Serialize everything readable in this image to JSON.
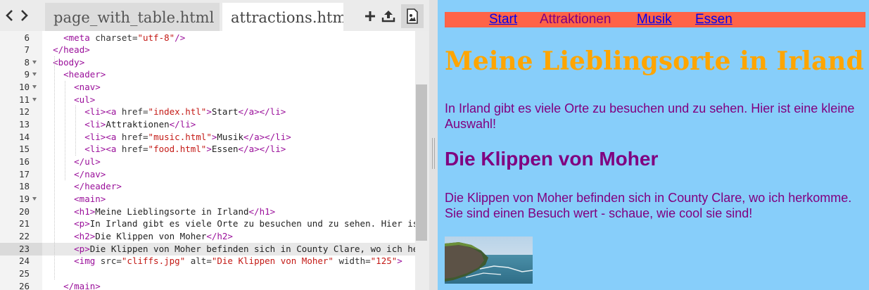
{
  "editor": {
    "tabs": [
      {
        "label": "page_with_table.html"
      },
      {
        "label": "attractions.html"
      }
    ],
    "lines": [
      {
        "num": "6",
        "fold": false
      },
      {
        "num": "7",
        "fold": false
      },
      {
        "num": "8",
        "fold": true
      },
      {
        "num": "9",
        "fold": true
      },
      {
        "num": "10",
        "fold": true
      },
      {
        "num": "11",
        "fold": true
      },
      {
        "num": "12",
        "fold": false
      },
      {
        "num": "13",
        "fold": false
      },
      {
        "num": "14",
        "fold": false
      },
      {
        "num": "15",
        "fold": false
      },
      {
        "num": "16",
        "fold": false
      },
      {
        "num": "17",
        "fold": false
      },
      {
        "num": "18",
        "fold": false
      },
      {
        "num": "19",
        "fold": true
      },
      {
        "num": "20",
        "fold": false
      },
      {
        "num": "21",
        "fold": false
      },
      {
        "num": "22",
        "fold": false
      },
      {
        "num": "23",
        "fold": false,
        "active": true
      },
      {
        "num": "24",
        "fold": false
      },
      {
        "num": "25",
        "fold": false
      },
      {
        "num": "26",
        "fold": false
      }
    ],
    "code": [
      {
        "indent": "    ",
        "parts": [
          [
            "tag",
            "<meta "
          ],
          [
            "attr",
            "charset="
          ],
          [
            "str",
            "\"utf-8\""
          ],
          [
            "tag",
            "/>"
          ]
        ]
      },
      {
        "indent": "  ",
        "parts": [
          [
            "tag",
            "</head>"
          ]
        ]
      },
      {
        "indent": "  ",
        "parts": [
          [
            "tag",
            "<body>"
          ]
        ]
      },
      {
        "indent": "    ",
        "parts": [
          [
            "tag",
            "<header>"
          ]
        ]
      },
      {
        "indent": "      ",
        "parts": [
          [
            "tag",
            "<nav>"
          ]
        ]
      },
      {
        "indent": "      ",
        "parts": [
          [
            "tag",
            "<ul>"
          ]
        ]
      },
      {
        "indent": "        ",
        "parts": [
          [
            "tag",
            "<li><a "
          ],
          [
            "attr",
            "href="
          ],
          [
            "str",
            "\"index.htl\""
          ],
          [
            "tag",
            ">"
          ],
          [
            "text",
            "Start"
          ],
          [
            "tag",
            "</a></li>"
          ]
        ]
      },
      {
        "indent": "        ",
        "parts": [
          [
            "tag",
            "<li>"
          ],
          [
            "text",
            "Attraktionen"
          ],
          [
            "tag",
            "</li>"
          ]
        ]
      },
      {
        "indent": "        ",
        "parts": [
          [
            "tag",
            "<li><a "
          ],
          [
            "attr",
            "href="
          ],
          [
            "str",
            "\"music.html\""
          ],
          [
            "tag",
            ">"
          ],
          [
            "text",
            "Musik"
          ],
          [
            "tag",
            "</a></li>"
          ]
        ]
      },
      {
        "indent": "        ",
        "parts": [
          [
            "tag",
            "<li><a "
          ],
          [
            "attr",
            "href="
          ],
          [
            "str",
            "\"food.html\""
          ],
          [
            "tag",
            ">"
          ],
          [
            "text",
            "Essen"
          ],
          [
            "tag",
            "</a></li>"
          ]
        ]
      },
      {
        "indent": "      ",
        "parts": [
          [
            "tag",
            "</ul>"
          ]
        ]
      },
      {
        "indent": "      ",
        "parts": [
          [
            "tag",
            "</nav>"
          ]
        ]
      },
      {
        "indent": "      ",
        "parts": [
          [
            "tag",
            "</header>"
          ]
        ]
      },
      {
        "indent": "      ",
        "parts": [
          [
            "tag",
            "<main>"
          ]
        ]
      },
      {
        "indent": "      ",
        "parts": [
          [
            "tag",
            "<h1>"
          ],
          [
            "text",
            "Meine Lieblingsorte in Irland"
          ],
          [
            "tag",
            "</h1>"
          ]
        ]
      },
      {
        "indent": "      ",
        "parts": [
          [
            "tag",
            "<p>"
          ],
          [
            "text",
            "In Irland gibt es viele Orte zu besuchen und zu sehen. Hier ist eine kleine Auswahl!"
          ],
          [
            "tag",
            "</p>"
          ]
        ]
      },
      {
        "indent": "      ",
        "parts": [
          [
            "tag",
            "<h2>"
          ],
          [
            "text",
            "Die Klippen von Moher"
          ],
          [
            "tag",
            "</h2>"
          ]
        ]
      },
      {
        "indent": "      ",
        "parts": [
          [
            "tag",
            "<p>"
          ],
          [
            "text",
            "Die Klippen von Moher befinden sich in County Clare, wo ich herkomme."
          ],
          [
            "tag",
            "</p>"
          ]
        ]
      },
      {
        "indent": "      ",
        "parts": [
          [
            "tag",
            "<img "
          ],
          [
            "attr",
            "src="
          ],
          [
            "str",
            "\"cliffs.jpg\""
          ],
          [
            "attr",
            " alt="
          ],
          [
            "str",
            "\"Die Klippen von Moher\""
          ],
          [
            "attr",
            " width="
          ],
          [
            "str",
            "\"125\""
          ],
          [
            "tag",
            ">"
          ]
        ]
      },
      {
        "indent": "",
        "parts": []
      },
      {
        "indent": "    ",
        "parts": [
          [
            "tag",
            "</main>"
          ]
        ]
      }
    ]
  },
  "preview": {
    "nav": {
      "start": "Start",
      "attraktionen": "Attraktionen",
      "musik": "Musik",
      "essen": "Essen"
    },
    "h1": "Meine Lieblingsorte in Irland",
    "p1": "In Irland gibt es viele Orte zu besuchen und zu sehen. Hier ist eine kleine Auswahl!",
    "h2": "Die Klippen von Moher",
    "p2": "Die Klippen von Moher befinden sich in County Clare, wo ich herkomme. Sie sind einen Besuch wert - schaue, wie cool sie sind!"
  },
  "colors": {
    "preview_bg": "#87cefa",
    "nav_bg": "#ff6347",
    "h1": "#ffa500",
    "text": "#800080",
    "link": "#0000ee"
  }
}
